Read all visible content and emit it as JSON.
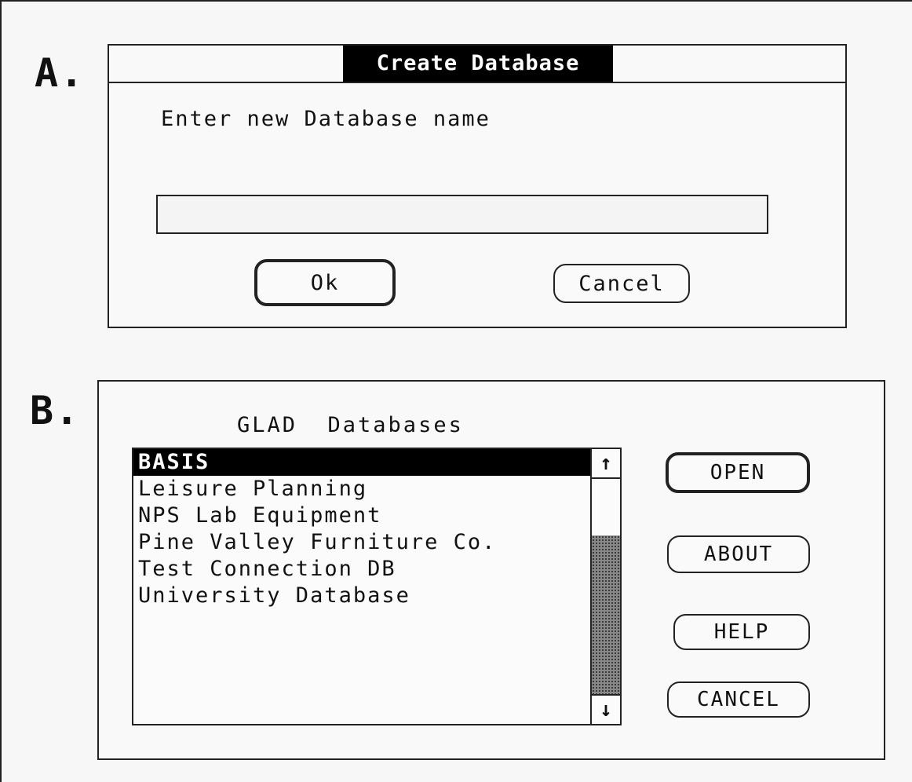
{
  "panel_a": {
    "label": "A.",
    "dialog_title": "Create Database",
    "prompt": "Enter new Database name",
    "input_value": "",
    "ok_label": "Ok",
    "cancel_label": "Cancel"
  },
  "panel_b": {
    "label": "B.",
    "list_title": "GLAD  Databases",
    "items": [
      {
        "label": "BASIS",
        "selected": true
      },
      {
        "label": "Leisure Planning",
        "selected": false
      },
      {
        "label": "NPS Lab Equipment",
        "selected": false
      },
      {
        "label": "Pine Valley Furniture Co.",
        "selected": false
      },
      {
        "label": "Test Connection DB",
        "selected": false
      },
      {
        "label": "University Database",
        "selected": false
      }
    ],
    "scroll_up_icon": "arrow-up-icon",
    "scroll_down_icon": "arrow-down-icon",
    "buttons": {
      "open": "OPEN",
      "about": "ABOUT",
      "help": "HELP",
      "cancel": "CANCEL"
    }
  }
}
